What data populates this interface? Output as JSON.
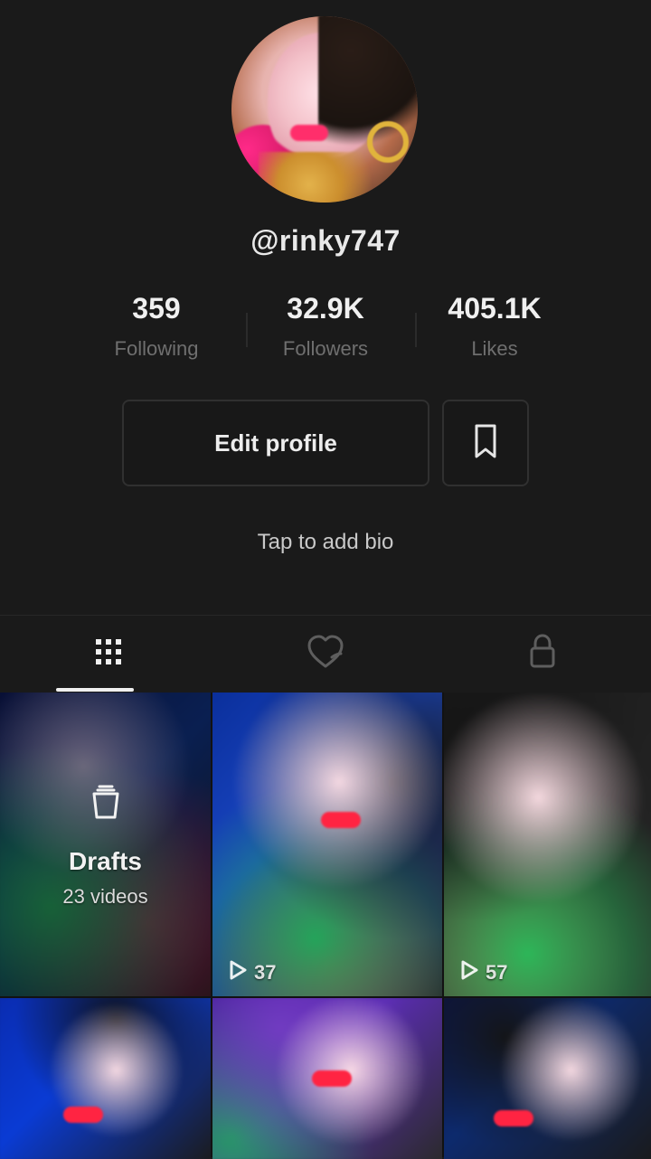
{
  "profile": {
    "username": "@rinky747",
    "bio_placeholder": "Tap to add bio"
  },
  "stats": [
    {
      "value": "359",
      "label": "Following"
    },
    {
      "value": "32.9K",
      "label": "Followers"
    },
    {
      "value": "405.1K",
      "label": "Likes"
    }
  ],
  "actions": {
    "edit_profile_label": "Edit profile"
  },
  "tabs": [
    {
      "name": "videos",
      "icon": "grid-icon",
      "active": true
    },
    {
      "name": "liked",
      "icon": "heart-icon",
      "active": false
    },
    {
      "name": "private",
      "icon": "lock-icon",
      "active": false
    }
  ],
  "grid": {
    "drafts_title": "Drafts",
    "drafts_count": "23 videos",
    "items": [
      {
        "type": "drafts"
      },
      {
        "type": "video",
        "views": "37"
      },
      {
        "type": "video",
        "views": "57"
      },
      {
        "type": "video",
        "views": ""
      },
      {
        "type": "video",
        "views": ""
      },
      {
        "type": "video",
        "views": ""
      }
    ]
  },
  "colors": {
    "background": "#1a1a1a",
    "text_primary": "#e9e9e9",
    "text_secondary": "#6f6f6f"
  }
}
